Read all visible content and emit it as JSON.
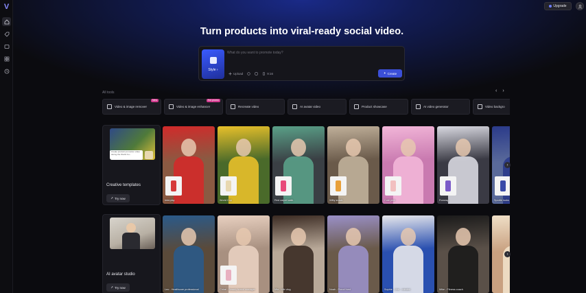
{
  "app": {
    "logo_text": "V",
    "upgrade_label": "Upgrade"
  },
  "sidebar": {
    "items": [
      {
        "name": "home-icon",
        "active": true
      },
      {
        "name": "tag-icon",
        "active": false
      },
      {
        "name": "media-icon",
        "active": false
      },
      {
        "name": "grid-icon",
        "active": false
      },
      {
        "name": "history-icon",
        "active": false
      }
    ]
  },
  "hero": {
    "headline": "Turn products into viral-ready social video."
  },
  "prompt": {
    "placeholder": "What do you want to promote today?",
    "style_label": "Style ›",
    "upload_label": "Upload",
    "ratio_label": "9:16",
    "create_label": "Create"
  },
  "tools": {
    "section_label": "All tools",
    "items": [
      {
        "label": "Video & image remover",
        "badge": "New"
      },
      {
        "label": "Video & image enhancer",
        "badge": "Hot promo"
      },
      {
        "label": "Recreate video",
        "badge": ""
      },
      {
        "label": "AI avatar video",
        "badge": ""
      },
      {
        "label": "Product showcase",
        "badge": ""
      },
      {
        "label": "AI video generator",
        "badge": ""
      },
      {
        "label": "Video backgro",
        "badge": ""
      }
    ]
  },
  "sections": [
    {
      "title": "Creative templates",
      "try_label": "Try now",
      "thumb_caption": "Create product promotion video during the World Cu...",
      "cards": [
        {
          "caption": "Interplay",
          "bg": "#8a5a42",
          "accent": "#d12a2a",
          "product": "#d63a3a"
        },
        {
          "caption": "World Cup",
          "bg": "#4a6a2a",
          "accent": "#e8c02a",
          "product": "#e8d8b0"
        },
        {
          "caption": "Red carpet walk",
          "bg": "#3a3f44",
          "accent": "#5aa088",
          "product": "#e84a7a"
        },
        {
          "caption": "Witty snack",
          "bg": "#6a5a4a",
          "accent": "#c0b09a",
          "product": "#e8a03a"
        },
        {
          "caption": "Cute pink",
          "bg": "#c97ab0",
          "accent": "#f2b6d8",
          "product": "#f2c0c0"
        },
        {
          "caption": "Runway",
          "bg": "#3a3a44",
          "accent": "#d8d8e0",
          "product": "#7a5ac8"
        },
        {
          "caption": "Sportie looks",
          "bg": "#5a6a9a",
          "accent": "#2a3a8a",
          "product": "#3a4aa8"
        }
      ]
    },
    {
      "title": "AI avatar studio",
      "try_label": "Try now",
      "cards": [
        {
          "caption": "Leo - Healthcare professional",
          "bg": "#5a4a3a",
          "accent": "#2a5a8a",
          "product": ""
        },
        {
          "caption": "Chloe - Beauty brand manager",
          "bg": "#a89080",
          "accent": "#e8d0c0",
          "product": "#e8b0c0"
        },
        {
          "caption": "Mia - Life vlog",
          "bg": "#b8a898",
          "accent": "#3a2a22",
          "product": ""
        },
        {
          "caption": "Noah - Proud host",
          "bg": "#6a5a4a",
          "accent": "#9a90c8",
          "product": ""
        },
        {
          "caption": "Sophie - Live - minded",
          "bg": "#2a50b0",
          "accent": "#e8e8ec",
          "product": ""
        },
        {
          "caption": "Mike - Fitness coach",
          "bg": "#5a5048",
          "accent": "#1a1a1a",
          "product": ""
        },
        {
          "caption": "",
          "bg": "#c8a080",
          "accent": "#f0e0c8",
          "product": ""
        }
      ]
    }
  ]
}
